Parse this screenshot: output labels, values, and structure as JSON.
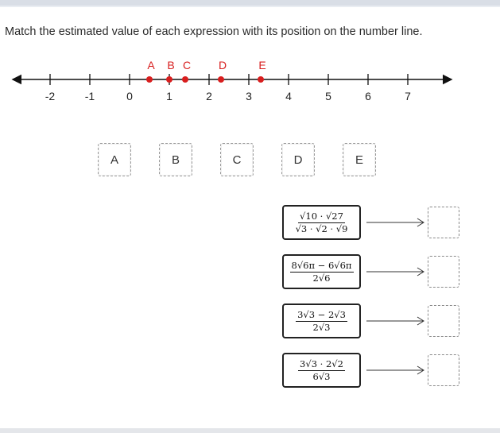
{
  "instruction": "Match the estimated value of each expression with its position on the number line.",
  "number_line": {
    "tick_labels": [
      "-2",
      "-1",
      "0",
      "1",
      "2",
      "3",
      "4",
      "5",
      "6",
      "7"
    ],
    "tick_values": [
      -2,
      -1,
      0,
      1,
      2,
      3,
      4,
      5,
      6,
      7
    ],
    "points": [
      {
        "label": "A",
        "value": 0.5
      },
      {
        "label": "B",
        "value": 1.0
      },
      {
        "label": "C",
        "value": 1.4
      },
      {
        "label": "D",
        "value": 2.3
      },
      {
        "label": "E",
        "value": 3.3
      }
    ],
    "point_color": "#d81e1e",
    "axis_color": "#111111"
  },
  "tiles": [
    "A",
    "B",
    "C",
    "D",
    "E"
  ],
  "expressions": [
    {
      "numerator": "√10 · √27",
      "denominator": "√3 · √2 · √9"
    },
    {
      "numerator": "8√6π − 6√6π",
      "denominator": "2√6"
    },
    {
      "numerator": "3√3 − 2√3",
      "denominator": "2√3"
    },
    {
      "numerator": "3√3 · 2√2",
      "denominator": "6√3"
    }
  ]
}
